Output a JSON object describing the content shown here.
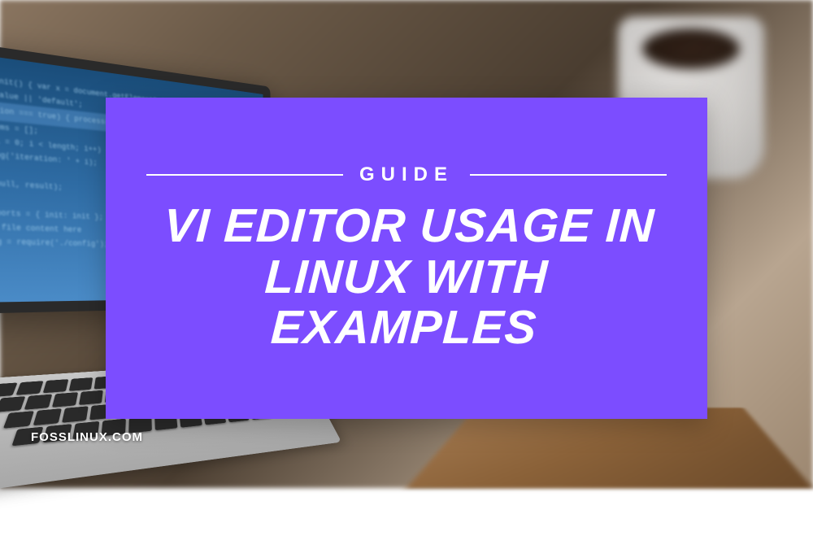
{
  "overlay": {
    "label": "GUIDE",
    "title": "VI EDITOR USAGE IN LINUX WITH EXAMPLES"
  },
  "watermark": "FOSSLINUX.COM",
  "colors": {
    "card_bg": "#7c4dff",
    "text": "#ffffff"
  }
}
